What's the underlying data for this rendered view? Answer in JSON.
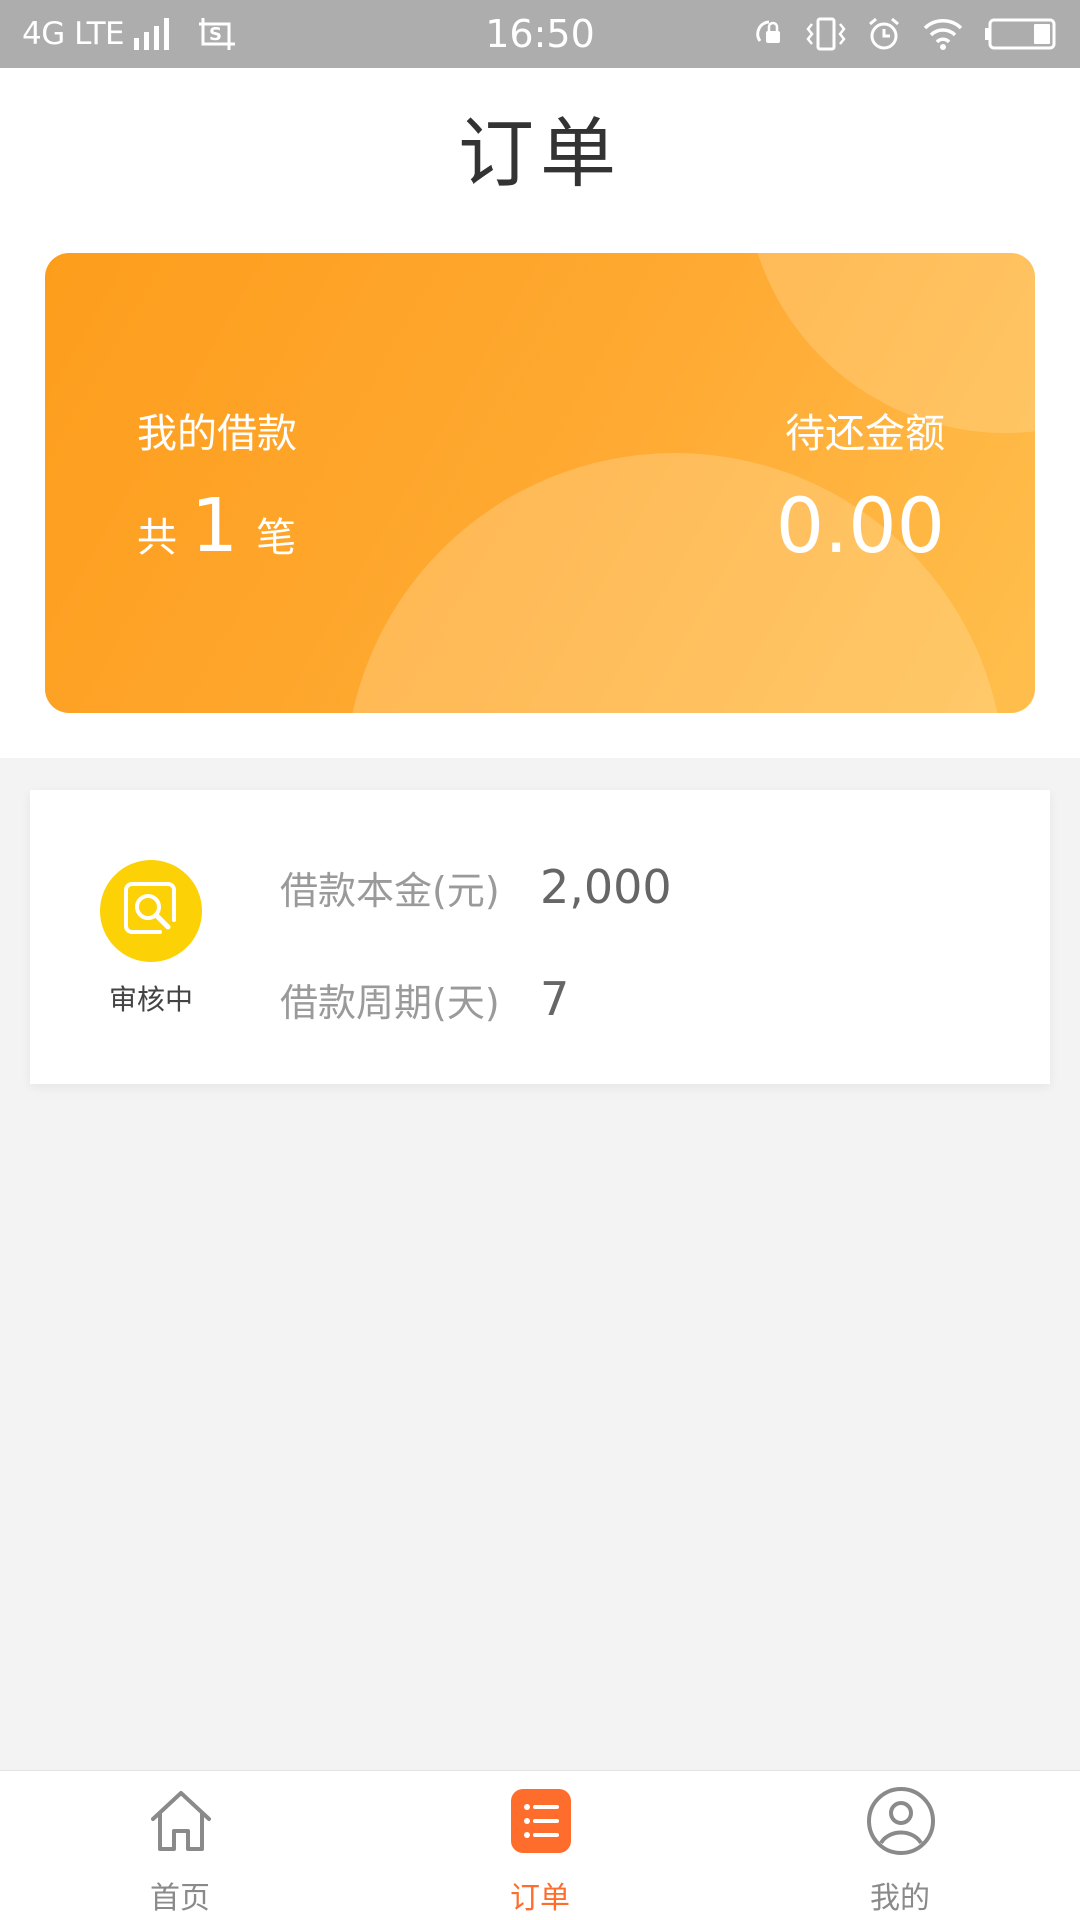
{
  "status_bar": {
    "network": "4G LTE",
    "time": "16:50",
    "icons": [
      "signal-icon",
      "screenshot-icon",
      "rotation-lock-icon",
      "vibrate-icon",
      "alarm-icon",
      "wifi-icon",
      "battery-icon"
    ]
  },
  "header": {
    "title": "订单"
  },
  "summary_card": {
    "loans_label": "我的借款",
    "count_prefix": "共",
    "count": "1",
    "count_suffix": "笔",
    "due_label": "待还金额",
    "due_amount": "0.00"
  },
  "order": {
    "status": "审核中",
    "principal_label": "借款本金(元)",
    "principal_value": "2,000",
    "term_label": "借款周期(天)",
    "term_value": "7"
  },
  "tabbar": {
    "items": [
      {
        "label": "首页",
        "icon": "home-icon",
        "active": false
      },
      {
        "label": "订单",
        "icon": "order-list-icon",
        "active": true
      },
      {
        "label": "我的",
        "icon": "profile-icon",
        "active": false
      }
    ]
  },
  "colors": {
    "accent": "#ff6d2d",
    "card_gradient_start": "#fd9d1c",
    "card_gradient_end": "#ffbf4d",
    "status_badge": "#fcd106"
  }
}
